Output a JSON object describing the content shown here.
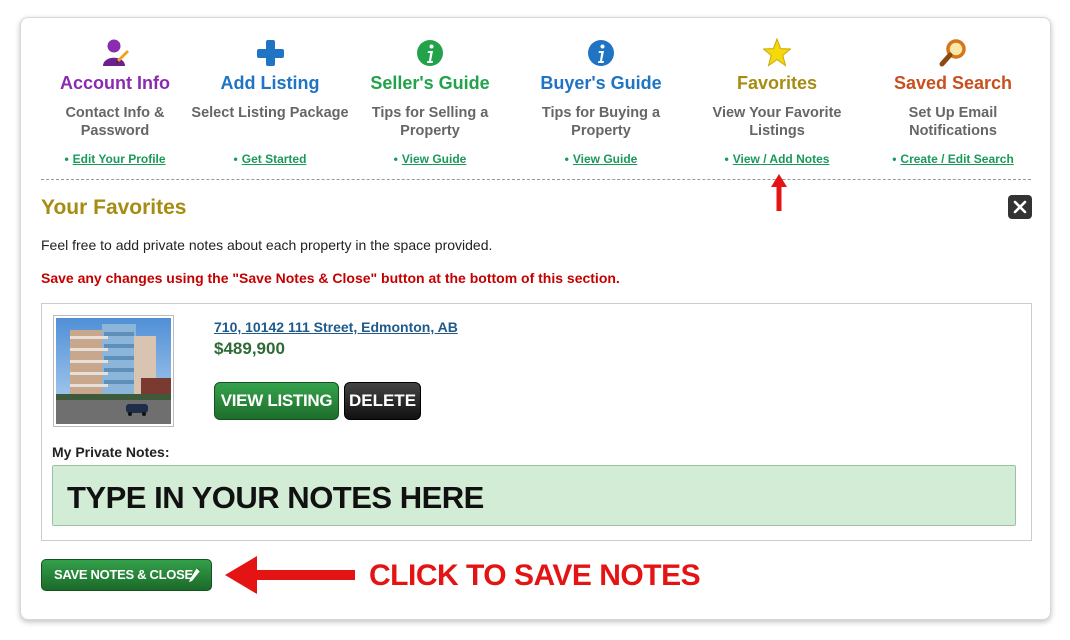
{
  "nav": [
    {
      "title": "Account Info",
      "desc": "Contact Info & Password",
      "link": "Edit Your Profile",
      "color": "#8a2bb0",
      "icon": "user-icon"
    },
    {
      "title": "Add Listing",
      "desc": "Select Listing Package",
      "link": "Get Started",
      "color": "#1f74c4",
      "icon": "plus-icon"
    },
    {
      "title": "Seller's Guide",
      "desc": "Tips for Selling a Property",
      "link": "View Guide",
      "color": "#22a34a",
      "icon": "info-icon"
    },
    {
      "title": "Buyer's Guide",
      "desc": "Tips for Buying a Property",
      "link": "View Guide",
      "color": "#1f74c4",
      "icon": "info-icon"
    },
    {
      "title": "Favorites",
      "desc": "View Your Favorite Listings",
      "link": "View / Add Notes",
      "color": "#a68c12",
      "icon": "star-icon"
    },
    {
      "title": "Saved Search",
      "desc": "Set Up Email Notifications",
      "link": "Create / Edit Search",
      "color": "#c8501e",
      "icon": "magnifier-icon"
    }
  ],
  "favorites": {
    "title": "Your Favorites",
    "intro": "Feel free to add private notes about each property in the space provided.",
    "warning": "Save any changes using the \"Save Notes & Close\" button at the bottom of this section.",
    "listing": {
      "address": "710, 10142 111 Street, Edmonton, AB",
      "price": "$489,900",
      "view_label": "VIEW LISTING",
      "delete_label": "DELETE"
    },
    "notes_label": "My Private Notes:",
    "notes_value": "TYPE IN YOUR NOTES HERE",
    "save_label": "SAVE NOTES & CLOSE"
  },
  "annotation": {
    "callout": "CLICK TO SAVE NOTES",
    "color": "#e41414"
  }
}
